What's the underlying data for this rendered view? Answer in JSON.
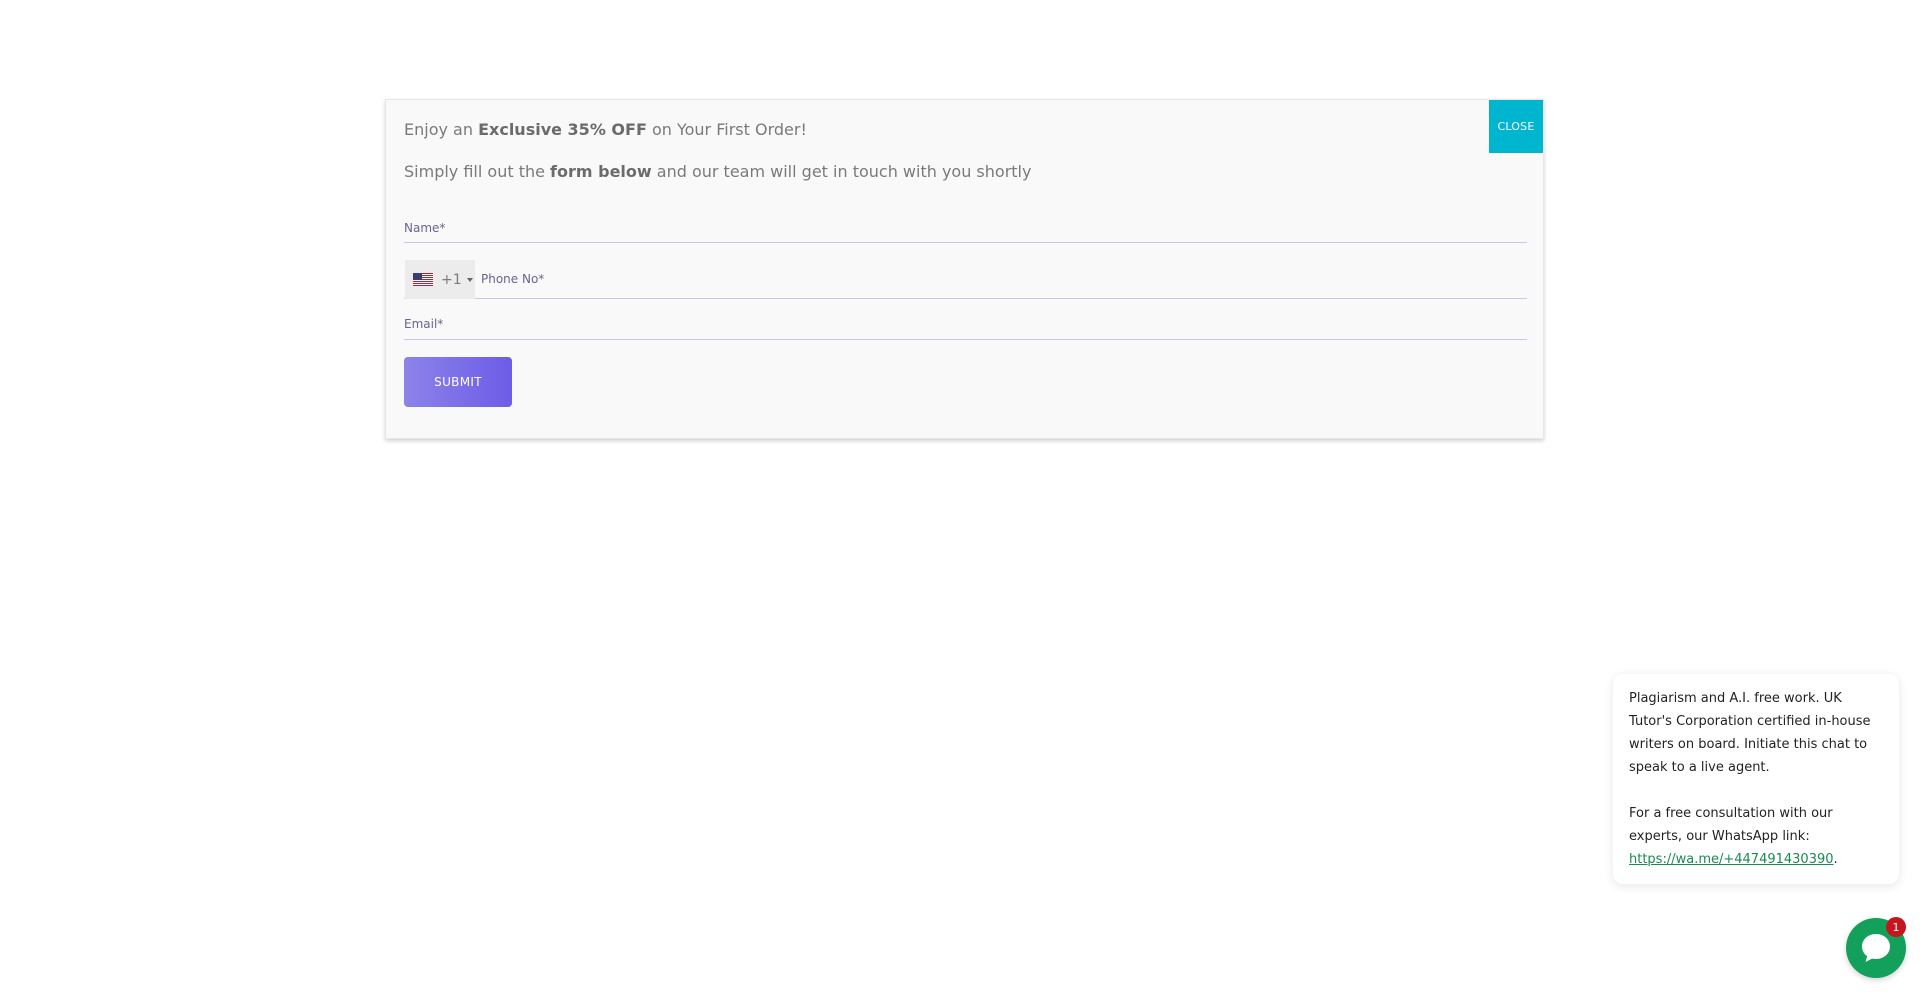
{
  "modal": {
    "headline_pre": "Enjoy an ",
    "headline_bold": "Exclusive 35% OFF",
    "headline_post": " on Your First Order!",
    "subline_pre": "Simply fill out the ",
    "subline_bold": "form below",
    "subline_post": " and our team will get in touch with you shortly",
    "close_label": "CLOSE",
    "name_placeholder": "Name*",
    "phone": {
      "country_icon": "us-flag-icon",
      "dial_code": "+1",
      "placeholder": "Phone No*"
    },
    "email_placeholder": "Email*",
    "submit_label": "SUBMIT"
  },
  "chat": {
    "message_p1": "Plagiarism and A.I. free work. UK Tutor's Corporation certified in-house writers on board. Initiate this chat to speak to a live agent.",
    "message_p2": "For a free consultation with our experts, our WhatsApp link:",
    "link_text": "https://wa.me/+447491430390",
    "link_suffix": ".",
    "launcher_icon": "chat-icon",
    "badge_count": "1"
  },
  "colors": {
    "close_button": "#00b5cf",
    "submit_gradient_start": "#8d83ea",
    "submit_gradient_end": "#6c5ce7",
    "chat_green": "#13a05a",
    "badge_red": "#c4161c"
  }
}
